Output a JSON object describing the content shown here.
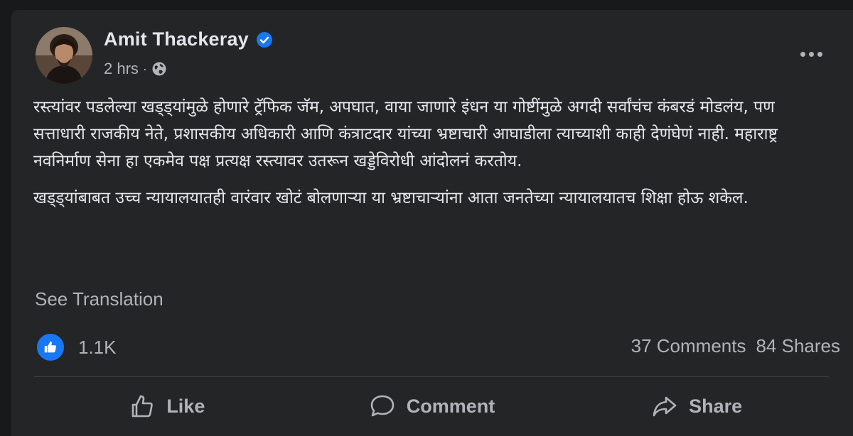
{
  "post": {
    "author": {
      "name": "Amit Thackeray",
      "verified": true
    },
    "timestamp": "2 hrs",
    "separator": "·",
    "audience_icon": "globe-icon",
    "paragraphs": [
      "रस्त्यांवर पडलेल्या खड्ड्यांमुळे होणारे ट्रॅफिक जॅम, अपघात, वाया जाणारे इंधन या गोष्टींमुळे अगदी सर्वांचंच कंबरडं मोडलंय, पण सत्ताधारी राजकीय नेते, प्रशासकीय अधिकारी आणि कंत्राटदार यांच्या भ्रष्टाचारी आघाडीला त्याच्याशी काही देणंघेणं नाही. महाराष्ट्र नवनिर्माण सेना हा एकमेव पक्ष प्रत्यक्ष रस्त्यावर उतरून खड्डेविरोधी आंदोलनं करतोय.",
      "खड्ड्यांबाबत उच्च न्यायालयातही वारंवार खोटं बोलणाऱ्या या भ्रष्टाचाऱ्यांना आता जनतेच्या न्यायालयातच शिक्षा होऊ शकेल."
    ],
    "see_translation": "See Translation",
    "reactions": {
      "icon": "like-reaction-icon",
      "count": "1.1K"
    },
    "comments": "37 Comments",
    "shares": "84 Shares",
    "actions": {
      "like": "Like",
      "comment": "Comment",
      "share": "Share"
    }
  },
  "colors": {
    "background": "#18191a",
    "card": "#242526",
    "primary_text": "#e4e6eb",
    "secondary_text": "#b0b3b8",
    "accent": "#1877f2",
    "divider": "#3e4042"
  }
}
